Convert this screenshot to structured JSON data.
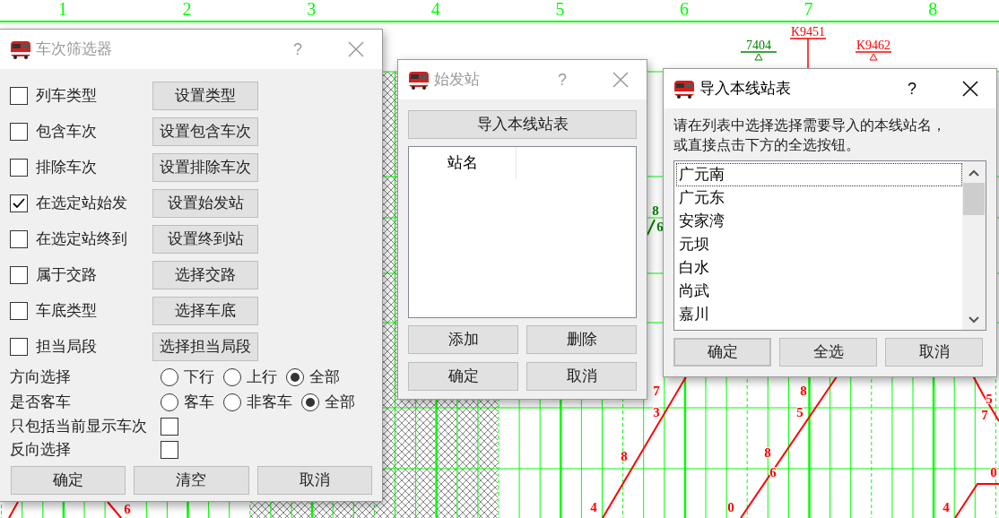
{
  "graph": {
    "hour_labels": [
      "1",
      "2",
      "3",
      "4",
      "5",
      "6",
      "7",
      "8"
    ],
    "train_labels": [
      {
        "text": "7404",
        "color": "#008000"
      },
      {
        "text": "K9451",
        "color": "#ff0000"
      },
      {
        "text": "K9462",
        "color": "#ff0000"
      }
    ],
    "minute_marks": [
      {
        "text": "8",
        "color": "#008000"
      },
      {
        "text": "6",
        "color": "#008000"
      },
      {
        "text": "7",
        "color": "#ff0000"
      },
      {
        "text": "3",
        "color": "#ff0000"
      },
      {
        "text": "8",
        "color": "#ff0000"
      },
      {
        "text": "4",
        "color": "#ff0000"
      },
      {
        "text": "8",
        "color": "#ff0000"
      },
      {
        "text": "5",
        "color": "#ff0000"
      },
      {
        "text": "8",
        "color": "#ff0000"
      },
      {
        "text": "6",
        "color": "#ff0000"
      },
      {
        "text": "0",
        "color": "#ff0000"
      },
      {
        "text": "5",
        "color": "#ff0000"
      },
      {
        "text": "7",
        "color": "#ff0000"
      },
      {
        "text": "4",
        "color": "#ff0000"
      },
      {
        "text": "0",
        "color": "#ff0000"
      },
      {
        "text": "6",
        "color": "#ff0000"
      }
    ]
  },
  "filter_dialog": {
    "title": "车次筛选器",
    "active": false,
    "help": "?",
    "criteria": [
      {
        "label": "列车类型",
        "checked": false,
        "button": "设置类型"
      },
      {
        "label": "包含车次",
        "checked": false,
        "button": "设置包含车次"
      },
      {
        "label": "排除车次",
        "checked": false,
        "button": "设置排除车次"
      },
      {
        "label": "在选定站始发",
        "checked": true,
        "button": "设置始发站"
      },
      {
        "label": "在选定站终到",
        "checked": false,
        "button": "设置终到站"
      },
      {
        "label": "属于交路",
        "checked": false,
        "button": "选择交路"
      },
      {
        "label": "车底类型",
        "checked": false,
        "button": "选择车底"
      },
      {
        "label": "担当局段",
        "checked": false,
        "button": "选择担当局段"
      }
    ],
    "radio_groups": [
      {
        "label": "方向选择",
        "options": [
          {
            "label": "下行",
            "selected": false
          },
          {
            "label": "上行",
            "selected": false
          },
          {
            "label": "全部",
            "selected": true
          }
        ]
      },
      {
        "label": "是否客车",
        "options": [
          {
            "label": "客车",
            "selected": false
          },
          {
            "label": "非客车",
            "selected": false
          },
          {
            "label": "全部",
            "selected": true
          }
        ]
      }
    ],
    "options": [
      {
        "label": "只包括当前显示车次",
        "checked": false
      },
      {
        "label": "反向选择",
        "checked": false
      }
    ],
    "buttons": [
      "确定",
      "清空",
      "取消"
    ]
  },
  "origin_dialog": {
    "title": "始发站",
    "active": false,
    "help": "?",
    "import_button": "导入本线站表",
    "column": "站名",
    "buttons": [
      "添加",
      "删除",
      "确定",
      "取消"
    ]
  },
  "import_dialog": {
    "title": "导入本线站表",
    "active": true,
    "help": "?",
    "instructions": [
      "请在列表中选择选择需要导入的本线站名，",
      "或直接点击下方的全选按钮。"
    ],
    "stations": [
      {
        "name": "广元南",
        "focused": true
      },
      {
        "name": "广元东",
        "focused": false
      },
      {
        "name": "安家湾",
        "focused": false
      },
      {
        "name": "元坝",
        "focused": false
      },
      {
        "name": "白水",
        "focused": false
      },
      {
        "name": "尚武",
        "focused": false
      },
      {
        "name": "嘉川",
        "focused": false
      }
    ],
    "buttons": [
      {
        "label": "确定",
        "default": true
      },
      {
        "label": "全选",
        "default": false
      },
      {
        "label": "取消",
        "default": false
      }
    ]
  }
}
